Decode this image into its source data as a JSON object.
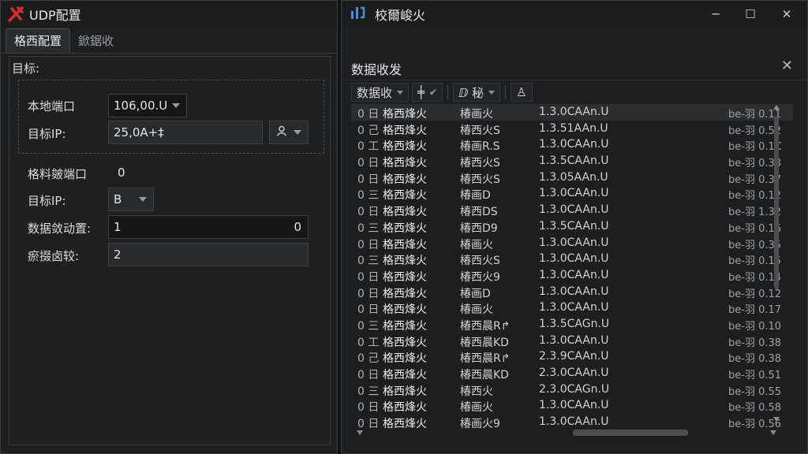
{
  "left_window": {
    "title": "UDP配置",
    "tabs": [
      "格西配置",
      "鍁鋸收"
    ],
    "section_title": "目标:",
    "local_port_label": "本地端口",
    "local_port_value": "106,00.U",
    "target_ip_label": "目标IP:",
    "target_ip_value": "25,0A+‡",
    "extra_label_1": "格料皴端口",
    "extra_value_1": "0",
    "target_ip2_label": "目标IP:",
    "target_ip2_value": "B",
    "data_pos_label": "数据敛动置:",
    "data_pos_value": "1",
    "data_pos_suffix": "0",
    "data_count_label": "瘀掇卤较:",
    "data_count_value": "2",
    "brand_color": "#d62c2c",
    "icons": [
      "logo-x-icon",
      "user-icon",
      "chevron-down-icon"
    ]
  },
  "right_window": {
    "title": "校爾峻火",
    "win_buttons": [
      "─",
      "☐",
      "✕"
    ],
    "panel_title": "数据收发",
    "close_label": "✕",
    "toolbar": {
      "dropdown_label": "数据收",
      "pin_label": "╪",
      "check_label": "✔",
      "mode_label": "ⅅ 秘",
      "icon_label": "♙"
    },
    "rows": [
      [
        "0 日",
        "格西烽火",
        "椿画火",
        "1.3.0CAAn.U",
        "be-羽 0.11"
      ],
      [
        "0 己",
        "格西烽火",
        "椿西火S",
        "1.3.51AAn.U",
        "be-羽 0.52"
      ],
      [
        "0 工",
        "格西烽火",
        "椿画R.S",
        "1.3.0CAAn.U",
        "be-羽 0.1C"
      ],
      [
        "0 日",
        "格西烽火",
        "椿西火S",
        "1.3.5CAAn.U",
        "be-羽 0.38"
      ],
      [
        "0 日",
        "格西烽火",
        "椿西火S",
        "1.3.05AAn.U",
        "be-羽 0.37"
      ],
      [
        "0 三",
        "格西烽火",
        "椿画D",
        "1.3.0CAAn.U",
        "be-羽 0.12"
      ],
      [
        "0 日",
        "格西烽火",
        "椿西DS",
        "1.3.0CAAn.U",
        "be-羽 1.32"
      ],
      [
        "0 三",
        "格西烽火",
        "椿西D9",
        "1.3.5CAAn.U",
        "be-羽 0.16"
      ],
      [
        "0 日",
        "格西烽火",
        "椿画火",
        "1.3.0CAAn.U",
        "be-羽 0.35"
      ],
      [
        "0 三",
        "格西烽火",
        "椿西火S",
        "1.3.0CAAn.U",
        "be-羽 0.15"
      ],
      [
        "0 日",
        "格西烽火",
        "椿西火9",
        "1.3.0CAAn.U",
        "be-羽 0.14"
      ],
      [
        "0 日",
        "格西烽火",
        "椿画D",
        "1.3.0CAAn.U",
        "be-羽 0.12"
      ],
      [
        "0 日",
        "格西烽火",
        "椿画火",
        "1.3.0CAAn.U",
        "be-羽 0.17"
      ],
      [
        "0 三",
        "格西烽火",
        "椿西晨R↱",
        "1.3.5CAGn.U",
        "be-羽 0.10"
      ],
      [
        "0 工",
        "格西烽火",
        "椿西晨KD",
        "1.3.0CAAn.U",
        "be-羽 0.38"
      ],
      [
        "0 己",
        "格西烽火",
        "椿西晨R↱",
        "2.3.9CAAn.U",
        "be-羽 0.38"
      ],
      [
        "0 日",
        "格西烽火",
        "椿西晨KD",
        "2.3.0CAAn.U",
        "be-羽 0.51"
      ],
      [
        "0 三",
        "格西烽火",
        "椿西火",
        "2.3.0CAGn.U",
        "be-羽 0.55"
      ],
      [
        "0 日",
        "格西烽火",
        "椿画火",
        "1.3.0CAAn.U",
        "be-羽 0.58"
      ],
      [
        "0 日",
        "格西烽火",
        "椿画火9",
        "1.3.0CAAn.U",
        "be-羽 0.56"
      ]
    ]
  }
}
